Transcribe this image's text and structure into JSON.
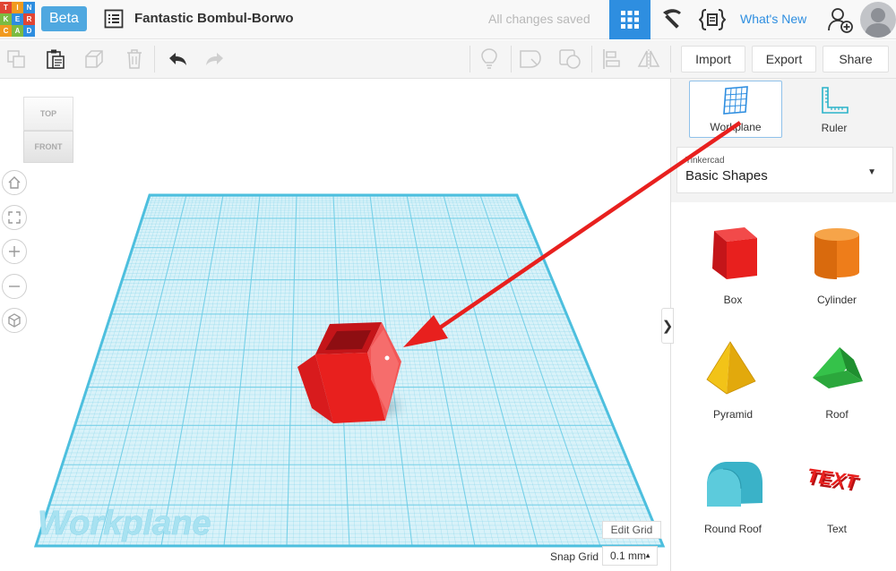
{
  "logo": {
    "letters": [
      "T",
      "I",
      "N",
      "K",
      "E",
      "R",
      "C",
      "A",
      "D"
    ],
    "colors": [
      "#e04534",
      "#f19a1e",
      "#2e8ee0",
      "#7cbb42",
      "#2e8ee0",
      "#e04534",
      "#f19a1e",
      "#7cbb42",
      "#2e8ee0"
    ]
  },
  "header": {
    "beta_label": "Beta",
    "design_title": "Fantastic Bombul-Borwo",
    "save_status": "All changes saved",
    "whats_new": "What's New"
  },
  "toolbar": {
    "import_label": "Import",
    "export_label": "Export",
    "share_label": "Share"
  },
  "viewcube": {
    "top_label": "TOP",
    "front_label": "FRONT"
  },
  "viewport": {
    "workplane_watermark": "Workplane",
    "edit_grid_label": "Edit Grid",
    "snap_grid_label": "Snap Grid",
    "snap_grid_value": "0.1 mm",
    "grid_color": "#6ccde6",
    "arrow_color": "#e8201e",
    "shape_color": "#e8201e"
  },
  "panel": {
    "tools": [
      {
        "label": "Workplane",
        "icon": "workplane-icon",
        "active": true
      },
      {
        "label": "Ruler",
        "icon": "ruler-icon",
        "active": false
      }
    ],
    "library_category": "Tinkercad",
    "library_name": "Basic Shapes",
    "shapes": [
      {
        "label": "Box",
        "icon": "box-icon",
        "color": "#e8201e"
      },
      {
        "label": "Cylinder",
        "icon": "cylinder-icon",
        "color": "#ee7d1a"
      },
      {
        "label": "Pyramid",
        "icon": "pyramid-icon",
        "color": "#f2c318"
      },
      {
        "label": "Roof",
        "icon": "roof-icon",
        "color": "#2ba73c"
      },
      {
        "label": "Round Roof",
        "icon": "round-roof-icon",
        "color": "#3ab2c8"
      },
      {
        "label": "Text",
        "icon": "text-shape-icon",
        "color": "#e8201e"
      }
    ],
    "shape_text_glyph": "TEXT",
    "collapse_glyph": "❯"
  }
}
